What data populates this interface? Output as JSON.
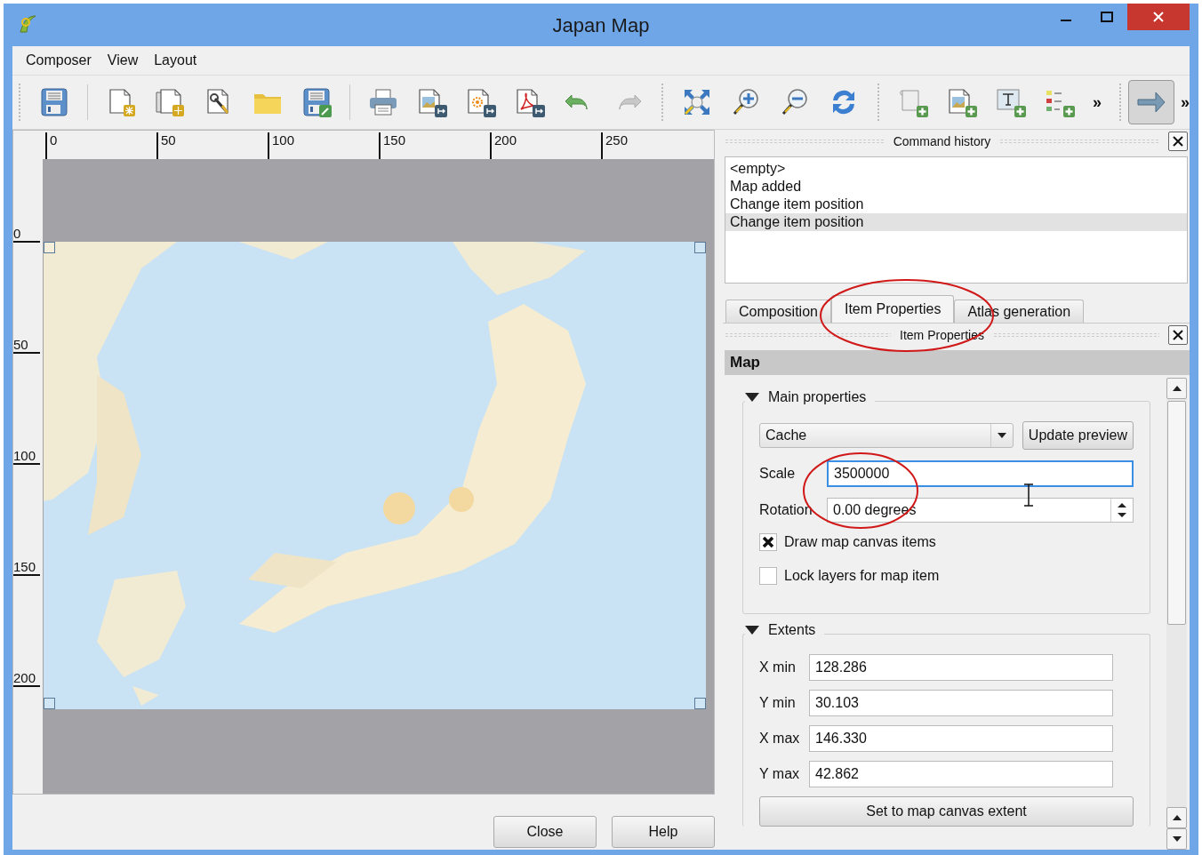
{
  "window": {
    "title": "Japan Map"
  },
  "menu": [
    "Composer",
    "View",
    "Layout"
  ],
  "toolbar": {
    "overflow_1": "»",
    "overflow_2": "»",
    "select_tool_active": true
  },
  "rulers": {
    "horizontal": [
      "0",
      "50",
      "100",
      "150",
      "200",
      "250"
    ],
    "vertical": [
      "0",
      "50",
      "100",
      "150",
      "200"
    ]
  },
  "map": {
    "kind": "picture"
  },
  "buttons": [
    "Close",
    "Help"
  ],
  "command_history": {
    "title": "Command history",
    "items": [
      {
        "text": "<empty>",
        "selected": false
      },
      {
        "text": "Map added",
        "selected": false
      },
      {
        "text": "Change item position",
        "selected": false
      },
      {
        "text": "Change item position",
        "selected": true
      }
    ]
  },
  "tabs": [
    {
      "label": "Composition",
      "selected": false
    },
    {
      "label": "Item Properties",
      "selected": true
    },
    {
      "label": "Atlas generation",
      "selected": false
    }
  ],
  "item_properties": {
    "title": "Item Properties",
    "header": "Map",
    "main_properties": {
      "title": "Main properties",
      "expanded": true,
      "cache_mode": "Cache",
      "update_button": "Update preview",
      "scale": {
        "label": "Scale",
        "value": "3500000",
        "focused": true
      },
      "rotation": {
        "label": "Rotation",
        "value": "0.00 degrees"
      },
      "checkboxes": [
        {
          "label": "Draw map canvas items",
          "checked": true
        },
        {
          "label": "Lock layers for map item",
          "checked": false
        }
      ]
    },
    "extents": {
      "title": "Extents",
      "expanded": true,
      "fields": [
        {
          "label": "X min",
          "value": "128.286"
        },
        {
          "label": "Y min",
          "value": "30.103"
        },
        {
          "label": "X max",
          "value": "146.330"
        },
        {
          "label": "Y max",
          "value": "42.862"
        }
      ],
      "button": "Set to map canvas extent"
    }
  }
}
